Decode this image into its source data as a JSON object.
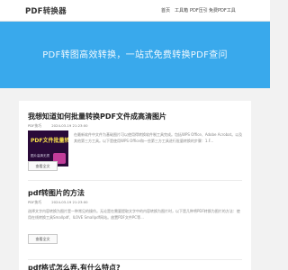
{
  "header": {
    "logo": "PDF转换器",
    "nav": [
      "首页",
      "工具箱",
      "PDF压引",
      "免费PDF工具"
    ]
  },
  "banner": {
    "title": "PDF转图高效转换，一站式免费转换PDF查问",
    "background": "#39a9ec"
  },
  "articles": [
    {
      "title": "我想知道如何批量转换PDF文件成高清图片",
      "meta": [
        "PDF技巧",
        "2024-03-19 21:23:00"
      ],
      "thumb": {
        "text": "PDF文件批量转",
        "subtext": "图片高清无损"
      },
      "excerpt": "在最新软件中文件为基础图片可以使用得转换软件制工具完成。包括WPS Office、Adobe Acrobat。以及其他第三方工具。以下是使用WPS Office和一些第三方工具进行批量转换的步骤：1.F...",
      "more": "查看全文"
    },
    {
      "title": "pdf转图片的方法",
      "meta": [
        "PDF技巧",
        "2024-03-19 21:23:00"
      ],
      "thumb": {
        "text": "",
        "subtext": ""
      },
      "excerpt": "选择文字内容转换为图片是一种常见的操作。无论是在需要提取文字中的内容转换为图片时，以下是几种将PDF转换为图片的方法：使用在线转换工具Smallpdf、ILOVE Smallpdf网站。放置PDF文件PC等...",
      "more": "查看全文"
    },
    {
      "title": "pdf格式怎么弄,有什么特点?",
      "meta": [],
      "thumb": {
        "text": "",
        "subtext": ""
      },
      "excerpt": "",
      "more": ""
    }
  ]
}
